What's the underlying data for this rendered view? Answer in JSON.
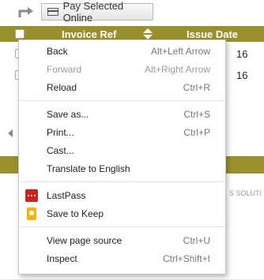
{
  "toolbar": {
    "pay_button_label": "Pay Selected Online"
  },
  "table": {
    "headers": {
      "invoice_ref": "Invoice Ref",
      "issue_date": "Issue Date"
    },
    "rows": [
      {
        "date_fragment": "16"
      },
      {
        "date_fragment": "16"
      }
    ]
  },
  "footer": {
    "text_fragment": "S SOLUTI"
  },
  "colors": {
    "header_olive": "#998f2d",
    "highlight": "#ffff33",
    "lastpass_red": "#c9241f",
    "keep_yellow": "#f6b400"
  },
  "context_menu": {
    "back": {
      "label": "Back",
      "shortcut": "Alt+Left Arrow"
    },
    "forward": {
      "label": "Forward",
      "shortcut": "Alt+Right Arrow"
    },
    "reload": {
      "label": "Reload",
      "shortcut": "Ctrl+R"
    },
    "save_as": {
      "label": "Save as...",
      "shortcut": "Ctrl+S"
    },
    "print": {
      "label": "Print...",
      "shortcut": "Ctrl+P"
    },
    "cast": {
      "label": "Cast..."
    },
    "translate": {
      "label": "Translate to English"
    },
    "lastpass": {
      "label": "LastPass",
      "icon": "lastpass-icon"
    },
    "save_to_keep": {
      "label": "Save to Keep",
      "icon": "keep-icon"
    },
    "view_source": {
      "label": "View page source",
      "shortcut": "Ctrl+U"
    },
    "inspect": {
      "label": "Inspect",
      "shortcut": "Ctrl+Shift+I"
    }
  }
}
